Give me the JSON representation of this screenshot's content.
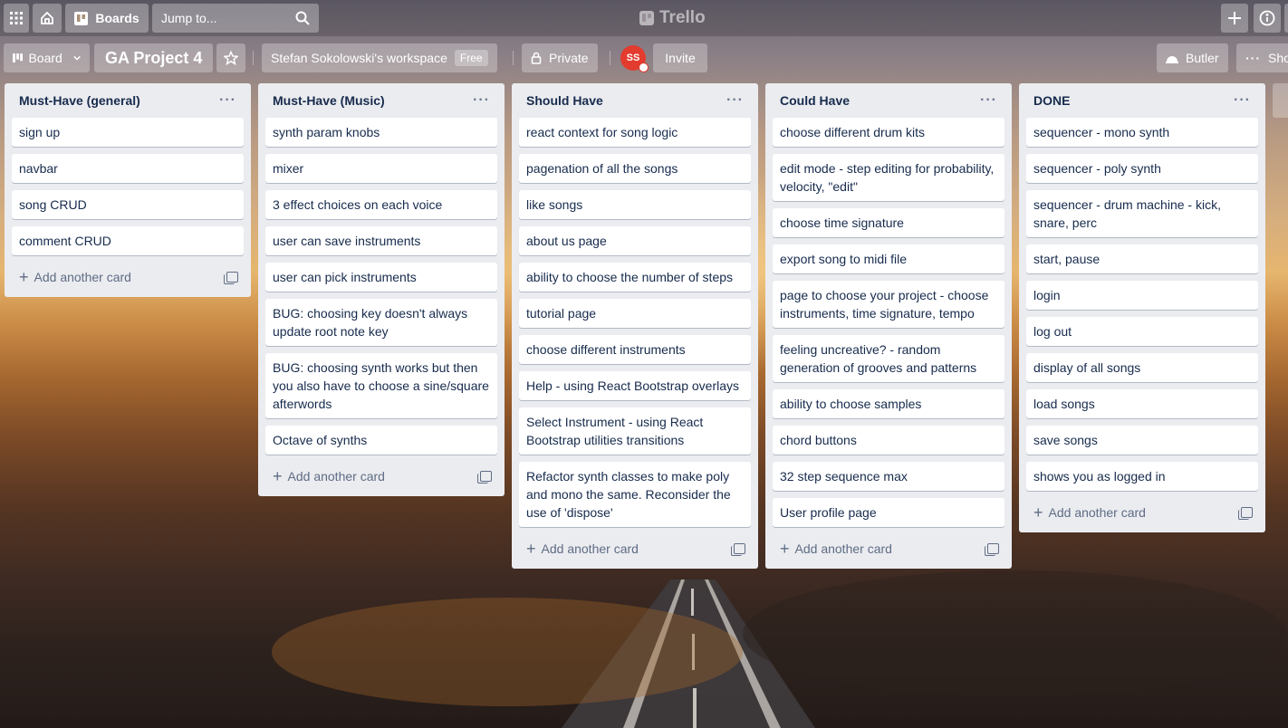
{
  "topbar": {
    "boards_label": "Boards",
    "search_placeholder": "Jump to...",
    "logo_text": "Trello"
  },
  "boardbar": {
    "view_label": "Board",
    "board_title": "GA Project 4",
    "workspace_label": "Stefan Sokolowski's workspace",
    "workspace_badge": "Free",
    "visibility_label": "Private",
    "avatar_initials": "SS",
    "invite_label": "Invite",
    "butler_label": "Butler",
    "show_menu_label": "Show"
  },
  "add_card_label": "Add another card",
  "lists": [
    {
      "title": "Must-Have (general)",
      "cards": [
        "sign up",
        "navbar",
        "song CRUD",
        "comment CRUD"
      ]
    },
    {
      "title": "Must-Have (Music)",
      "cards": [
        "synth param knobs",
        "mixer",
        "3 effect choices on each voice",
        "user can save instruments",
        "user can pick instruments",
        "BUG: choosing key doesn't always update root note key",
        "BUG: choosing synth works but then you also have to choose a sine/square afterwords",
        "Octave of synths"
      ]
    },
    {
      "title": "Should Have",
      "cards": [
        "react context for song logic",
        "pagenation of all the songs",
        "like songs",
        "about us page",
        "ability to choose the number of steps",
        "tutorial page",
        "choose different instruments",
        "Help - using React Bootstrap overlays",
        "Select Instrument - using React Bootstrap utilities transitions",
        "Refactor synth classes to make poly and mono the same. Reconsider the use of 'dispose'"
      ]
    },
    {
      "title": "Could Have",
      "cards": [
        "choose different drum kits",
        "edit mode - step editing for probability, velocity, \"edit\"",
        "choose time signature",
        "export song to midi file",
        "page to choose your project - choose instruments, time signature, tempo",
        "feeling uncreative? - random generation of grooves and patterns",
        "ability to choose samples",
        "chord buttons",
        "32 step sequence max",
        "User profile page"
      ]
    },
    {
      "title": "DONE",
      "cards": [
        "sequencer - mono synth",
        "sequencer - poly synth",
        "sequencer - drum machine - kick, snare, perc",
        "start, pause",
        "login",
        "log out",
        "display of all songs",
        "load songs",
        "save songs",
        "shows you as logged in"
      ]
    }
  ]
}
